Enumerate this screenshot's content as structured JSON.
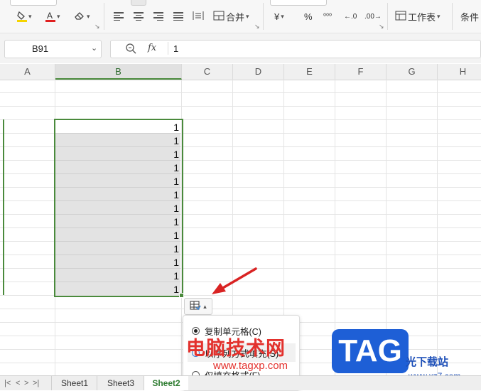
{
  "ribbon": {
    "merge_label": "合并",
    "currency_symbol": "¥",
    "percent_symbol": "%",
    "worksheet_label": "工作表",
    "conditional_label": "条件"
  },
  "name_box": {
    "value": "B91"
  },
  "formula_bar": {
    "fx_label": "fx",
    "value": "1"
  },
  "columns": [
    "A",
    "B",
    "C",
    "D",
    "E",
    "F",
    "G",
    "H"
  ],
  "selected_column": "B",
  "cells": {
    "b_values": [
      "1",
      "1",
      "1",
      "1",
      "1",
      "1",
      "1",
      "1",
      "1",
      "1",
      "1",
      "1",
      "1"
    ]
  },
  "paste_options": {
    "options": [
      {
        "label": "复制单元格(C)",
        "selected": true
      },
      {
        "label": "以序列方式填充(S)",
        "selected": false
      },
      {
        "label": "仅填充格式(F)",
        "selected": false
      }
    ]
  },
  "sheet_tabs": {
    "tabs": [
      "Sheet1",
      "Sheet3",
      "Sheet2"
    ],
    "active": "Sheet2"
  },
  "watermark": {
    "site_name": "电脑技术网",
    "site_url": "www.tagxp.com",
    "logo_text": "TAG",
    "right_text": "光下载站",
    "right_url": "www.xz7.com"
  },
  "colors": {
    "accent_green": "#4a8a3c",
    "arrow_red": "#d92323",
    "watermark_red": "#e3312d",
    "tag_blue": "#1e5fd6"
  }
}
